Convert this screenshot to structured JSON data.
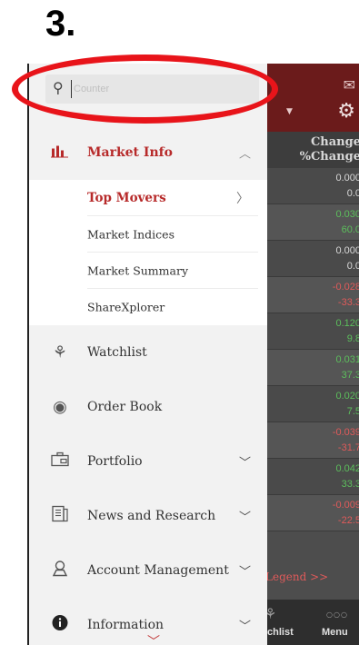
{
  "step_label": "3.",
  "search": {
    "placeholder": "Counter"
  },
  "menu": {
    "market_info": {
      "label": "Market Info",
      "icon": "bar-chart-icon"
    },
    "sub_items": [
      {
        "label": "Top Movers",
        "active": true
      },
      {
        "label": "Market Indices"
      },
      {
        "label": "Market Summary"
      },
      {
        "label": "ShareXplorer"
      }
    ],
    "watchlist": {
      "label": "Watchlist",
      "icon": "tree-icon"
    },
    "order_book": {
      "label": "Order Book",
      "icon": "order-book-icon"
    },
    "portfolio": {
      "label": "Portfolio",
      "icon": "briefcase-icon"
    },
    "news": {
      "label": "News and Research",
      "icon": "news-icon"
    },
    "account": {
      "label": "Account Management",
      "icon": "user-icon"
    },
    "information": {
      "label": "Information",
      "icon": "info-icon"
    }
  },
  "background": {
    "column_header": {
      "line1": "Change",
      "line2": "%Change"
    },
    "rows": [
      {
        "value": "0.000",
        "pct": "0.0",
        "trend": "neutral"
      },
      {
        "value": "0.030",
        "pct": "60.0",
        "trend": "up"
      },
      {
        "value": "0.000",
        "pct": "0.0",
        "trend": "neutral"
      },
      {
        "value": "-0.028",
        "pct": "-33.3",
        "trend": "down"
      },
      {
        "value": "0.120",
        "pct": "9.8",
        "trend": "up"
      },
      {
        "value": "0.031",
        "pct": "37.3",
        "trend": "up"
      },
      {
        "value": "0.020",
        "pct": "7.5",
        "trend": "up"
      },
      {
        "value": "-0.039",
        "pct": "-31.7",
        "trend": "down"
      },
      {
        "value": "0.042",
        "pct": "33.3",
        "trend": "up"
      },
      {
        "value": "-0.009",
        "pct": "-22.5",
        "trend": "down"
      }
    ],
    "legend": "Legend >>",
    "tabs": {
      "watchlist": "chlist",
      "menu": "Menu"
    }
  },
  "colors": {
    "accent": "#b72a2a",
    "highlight": "#e8141a",
    "header_bg": "#6b1b1b"
  }
}
